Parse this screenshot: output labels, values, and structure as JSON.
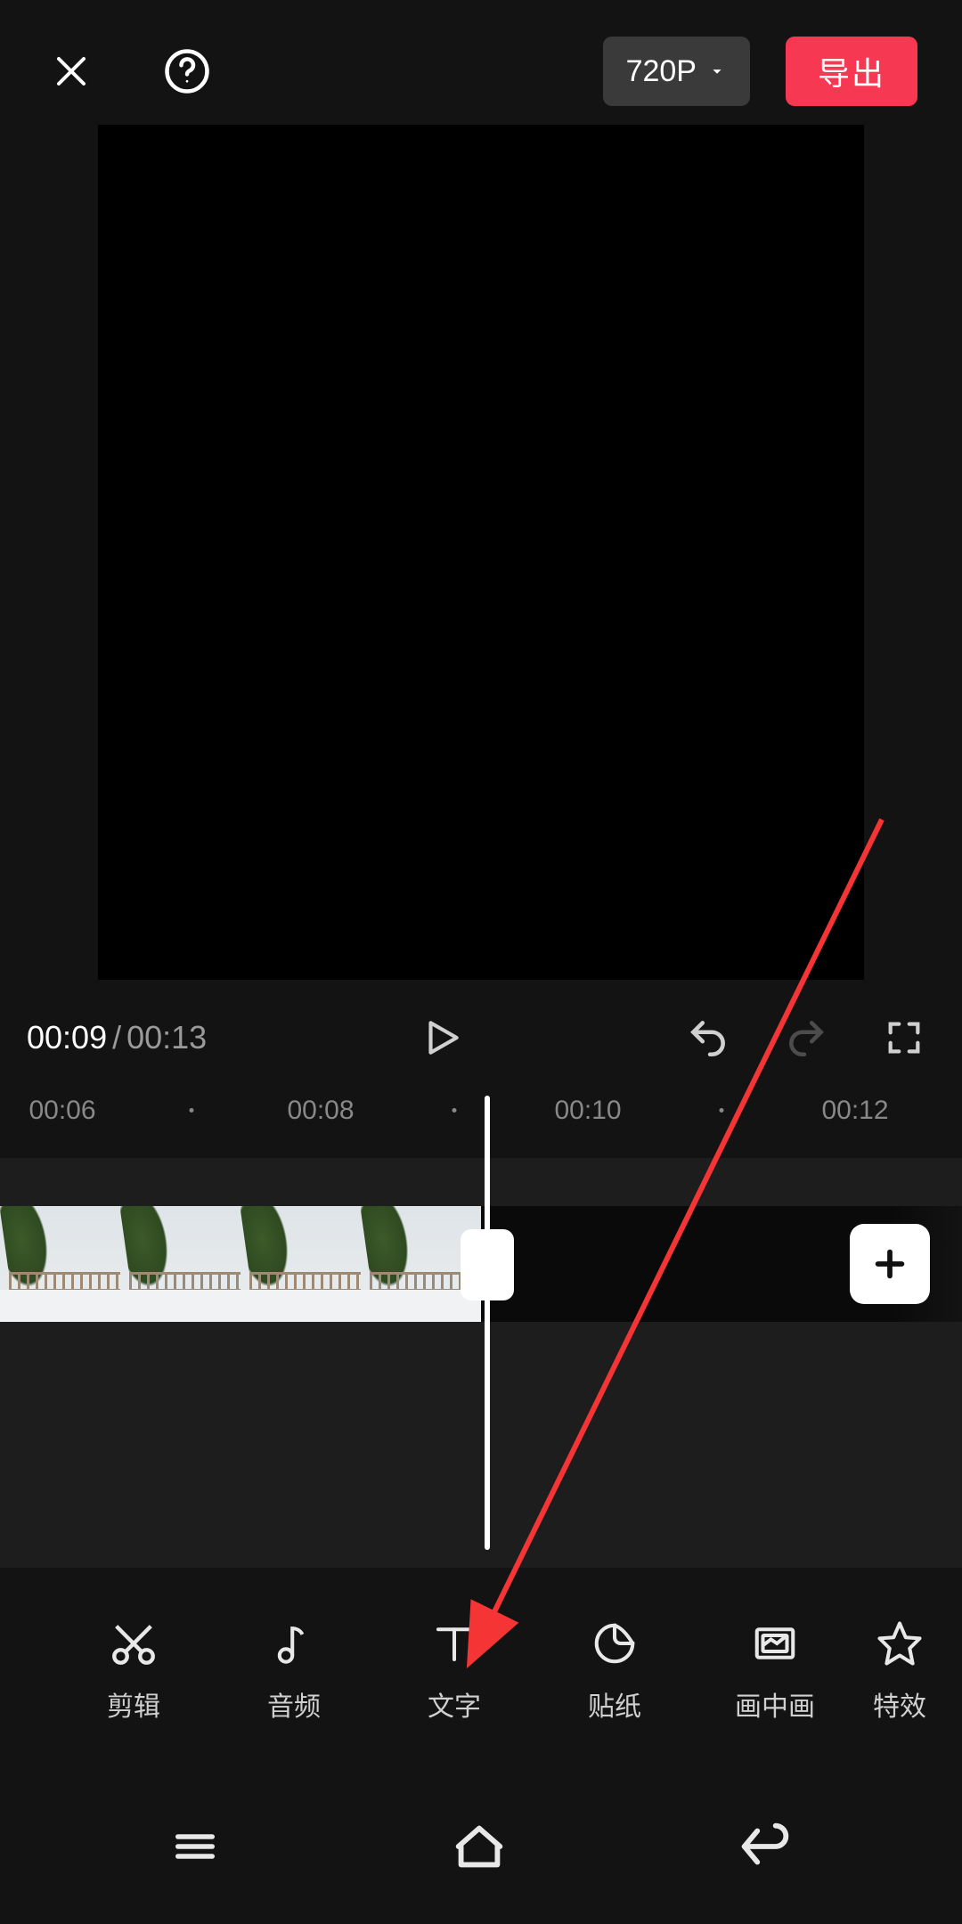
{
  "header": {
    "resolution_label": "720P",
    "export_label": "导出"
  },
  "transport": {
    "current_time": "00:09",
    "duration": "00:13"
  },
  "ruler": {
    "ticks": [
      "00:06",
      "00:08",
      "00:10",
      "00:12"
    ]
  },
  "tools": [
    {
      "id": "cut",
      "label": "剪辑",
      "icon": "scissors-icon"
    },
    {
      "id": "audio",
      "label": "音频",
      "icon": "music-note-icon"
    },
    {
      "id": "text",
      "label": "文字",
      "icon": "text-icon"
    },
    {
      "id": "sticker",
      "label": "贴纸",
      "icon": "sticker-icon"
    },
    {
      "id": "pip",
      "label": "画中画",
      "icon": "pip-icon"
    },
    {
      "id": "fx",
      "label": "特效",
      "icon": "star-icon"
    }
  ],
  "annotation": {
    "target_tool_id": "text"
  },
  "colors": {
    "accent": "#f63853"
  }
}
